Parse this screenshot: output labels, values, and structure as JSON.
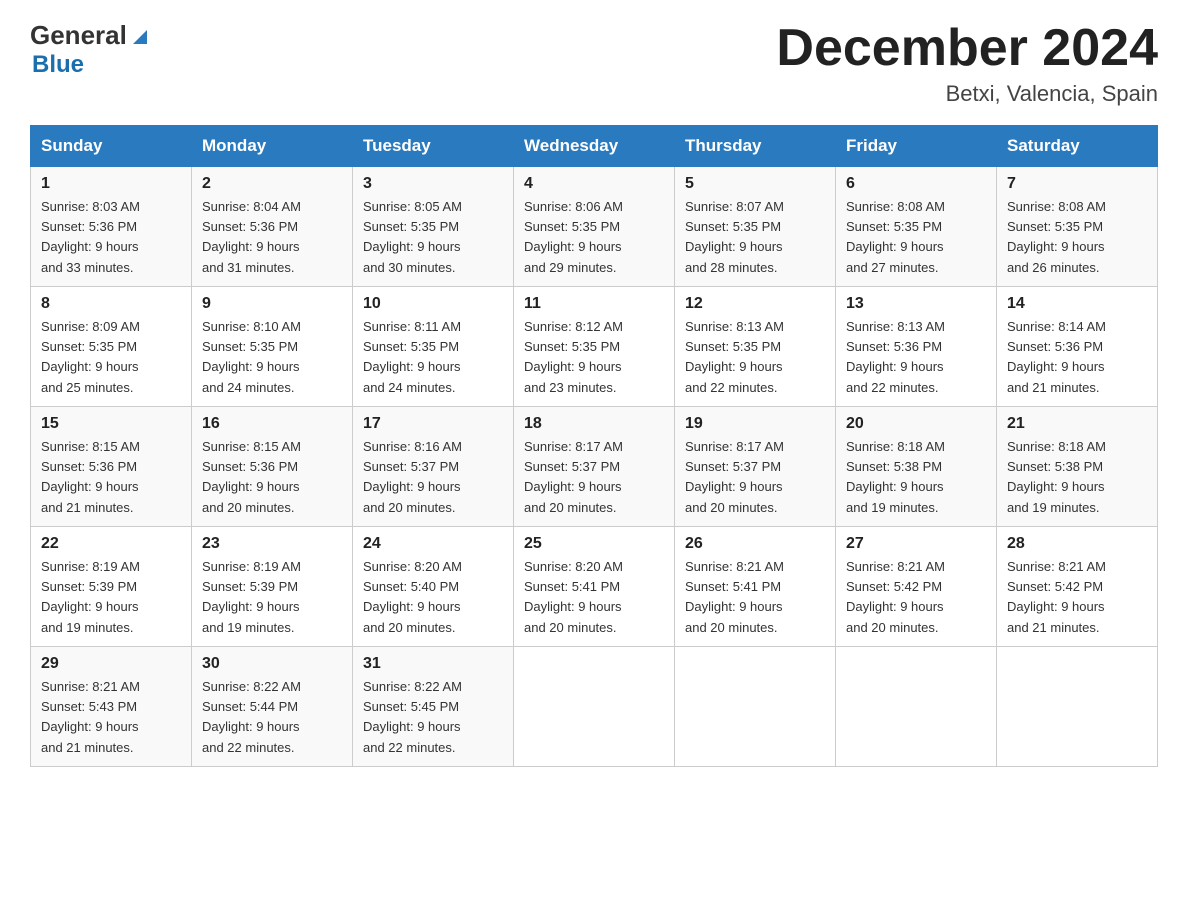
{
  "header": {
    "logo_general": "General",
    "logo_blue": "Blue",
    "title": "December 2024",
    "subtitle": "Betxi, Valencia, Spain"
  },
  "weekdays": [
    "Sunday",
    "Monday",
    "Tuesday",
    "Wednesday",
    "Thursday",
    "Friday",
    "Saturday"
  ],
  "weeks": [
    [
      {
        "day": "1",
        "sunrise": "8:03 AM",
        "sunset": "5:36 PM",
        "daylight": "9 hours and 33 minutes."
      },
      {
        "day": "2",
        "sunrise": "8:04 AM",
        "sunset": "5:36 PM",
        "daylight": "9 hours and 31 minutes."
      },
      {
        "day": "3",
        "sunrise": "8:05 AM",
        "sunset": "5:35 PM",
        "daylight": "9 hours and 30 minutes."
      },
      {
        "day": "4",
        "sunrise": "8:06 AM",
        "sunset": "5:35 PM",
        "daylight": "9 hours and 29 minutes."
      },
      {
        "day": "5",
        "sunrise": "8:07 AM",
        "sunset": "5:35 PM",
        "daylight": "9 hours and 28 minutes."
      },
      {
        "day": "6",
        "sunrise": "8:08 AM",
        "sunset": "5:35 PM",
        "daylight": "9 hours and 27 minutes."
      },
      {
        "day": "7",
        "sunrise": "8:08 AM",
        "sunset": "5:35 PM",
        "daylight": "9 hours and 26 minutes."
      }
    ],
    [
      {
        "day": "8",
        "sunrise": "8:09 AM",
        "sunset": "5:35 PM",
        "daylight": "9 hours and 25 minutes."
      },
      {
        "day": "9",
        "sunrise": "8:10 AM",
        "sunset": "5:35 PM",
        "daylight": "9 hours and 24 minutes."
      },
      {
        "day": "10",
        "sunrise": "8:11 AM",
        "sunset": "5:35 PM",
        "daylight": "9 hours and 24 minutes."
      },
      {
        "day": "11",
        "sunrise": "8:12 AM",
        "sunset": "5:35 PM",
        "daylight": "9 hours and 23 minutes."
      },
      {
        "day": "12",
        "sunrise": "8:13 AM",
        "sunset": "5:35 PM",
        "daylight": "9 hours and 22 minutes."
      },
      {
        "day": "13",
        "sunrise": "8:13 AM",
        "sunset": "5:36 PM",
        "daylight": "9 hours and 22 minutes."
      },
      {
        "day": "14",
        "sunrise": "8:14 AM",
        "sunset": "5:36 PM",
        "daylight": "9 hours and 21 minutes."
      }
    ],
    [
      {
        "day": "15",
        "sunrise": "8:15 AM",
        "sunset": "5:36 PM",
        "daylight": "9 hours and 21 minutes."
      },
      {
        "day": "16",
        "sunrise": "8:15 AM",
        "sunset": "5:36 PM",
        "daylight": "9 hours and 20 minutes."
      },
      {
        "day": "17",
        "sunrise": "8:16 AM",
        "sunset": "5:37 PM",
        "daylight": "9 hours and 20 minutes."
      },
      {
        "day": "18",
        "sunrise": "8:17 AM",
        "sunset": "5:37 PM",
        "daylight": "9 hours and 20 minutes."
      },
      {
        "day": "19",
        "sunrise": "8:17 AM",
        "sunset": "5:37 PM",
        "daylight": "9 hours and 20 minutes."
      },
      {
        "day": "20",
        "sunrise": "8:18 AM",
        "sunset": "5:38 PM",
        "daylight": "9 hours and 19 minutes."
      },
      {
        "day": "21",
        "sunrise": "8:18 AM",
        "sunset": "5:38 PM",
        "daylight": "9 hours and 19 minutes."
      }
    ],
    [
      {
        "day": "22",
        "sunrise": "8:19 AM",
        "sunset": "5:39 PM",
        "daylight": "9 hours and 19 minutes."
      },
      {
        "day": "23",
        "sunrise": "8:19 AM",
        "sunset": "5:39 PM",
        "daylight": "9 hours and 19 minutes."
      },
      {
        "day": "24",
        "sunrise": "8:20 AM",
        "sunset": "5:40 PM",
        "daylight": "9 hours and 20 minutes."
      },
      {
        "day": "25",
        "sunrise": "8:20 AM",
        "sunset": "5:41 PM",
        "daylight": "9 hours and 20 minutes."
      },
      {
        "day": "26",
        "sunrise": "8:21 AM",
        "sunset": "5:41 PM",
        "daylight": "9 hours and 20 minutes."
      },
      {
        "day": "27",
        "sunrise": "8:21 AM",
        "sunset": "5:42 PM",
        "daylight": "9 hours and 20 minutes."
      },
      {
        "day": "28",
        "sunrise": "8:21 AM",
        "sunset": "5:42 PM",
        "daylight": "9 hours and 21 minutes."
      }
    ],
    [
      {
        "day": "29",
        "sunrise": "8:21 AM",
        "sunset": "5:43 PM",
        "daylight": "9 hours and 21 minutes."
      },
      {
        "day": "30",
        "sunrise": "8:22 AM",
        "sunset": "5:44 PM",
        "daylight": "9 hours and 22 minutes."
      },
      {
        "day": "31",
        "sunrise": "8:22 AM",
        "sunset": "5:45 PM",
        "daylight": "9 hours and 22 minutes."
      },
      null,
      null,
      null,
      null
    ]
  ],
  "labels": {
    "sunrise": "Sunrise:",
    "sunset": "Sunset:",
    "daylight": "Daylight:"
  }
}
